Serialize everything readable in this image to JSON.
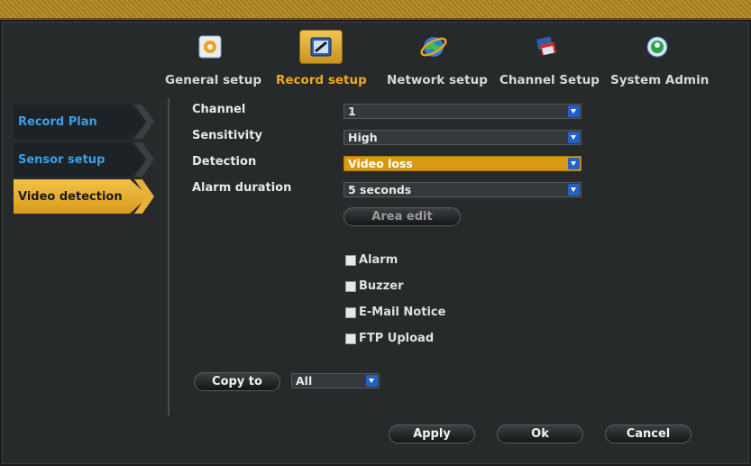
{
  "tabs": [
    {
      "label": "General setup",
      "icon": "gear-box-icon",
      "active": false
    },
    {
      "label": "Record setup",
      "icon": "record-book-icon",
      "active": true
    },
    {
      "label": "Network setup",
      "icon": "globe-icon",
      "active": false
    },
    {
      "label": "Channel Setup",
      "icon": "channel-icon",
      "active": false
    },
    {
      "label": "System Admin",
      "icon": "admin-icon",
      "active": false
    }
  ],
  "sidebar": {
    "items": [
      {
        "label": "Record Plan",
        "active": false
      },
      {
        "label": "Sensor setup",
        "active": false
      },
      {
        "label": "Video detection",
        "active": true
      }
    ]
  },
  "form": {
    "channel": {
      "label": "Channel",
      "value": "1"
    },
    "sensitivity": {
      "label": "Sensitivity",
      "value": "High"
    },
    "detection": {
      "label": "Detection",
      "value": "Video loss"
    },
    "alarm_duration": {
      "label": "Alarm duration",
      "value": "5 seconds"
    },
    "area_edit_label": "Area edit"
  },
  "options": {
    "alarm": "Alarm",
    "buzzer": "Buzzer",
    "email_notice": "E-Mail Notice",
    "ftp_upload": "FTP Upload"
  },
  "copy": {
    "button_label": "Copy to",
    "target_value": "All"
  },
  "footer": {
    "apply_label": "Apply",
    "ok_label": "Ok",
    "cancel_label": "Cancel"
  },
  "colors": {
    "accent": "#f0a820",
    "link_blue": "#3aa0e8",
    "highlight": "#d99a12"
  }
}
